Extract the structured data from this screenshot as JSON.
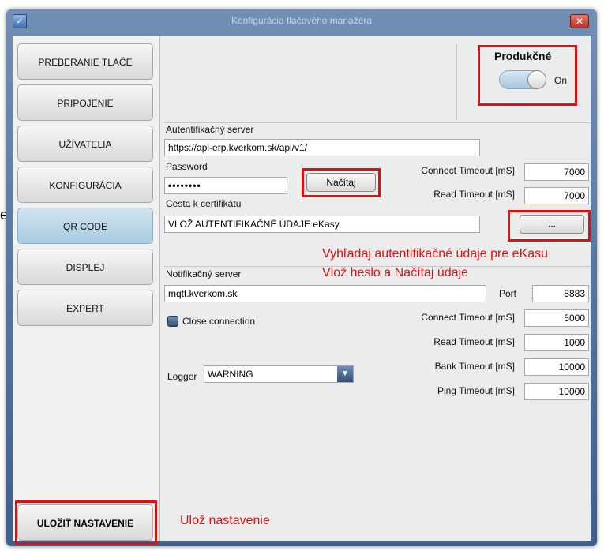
{
  "stray_text": "e",
  "window": {
    "title": "Konfigurácia tlačového manažéra",
    "close_glyph": "✕",
    "app_glyph": "✓"
  },
  "sidebar": {
    "items": [
      {
        "label": "PREBERANIE TLAČE"
      },
      {
        "label": "PRIPOJENIE"
      },
      {
        "label": "UŽÍVATELIA"
      },
      {
        "label": "KONFIGURÁCIA"
      },
      {
        "label": "QR CODE"
      },
      {
        "label": "DISPLEJ"
      },
      {
        "label": "EXPERT"
      }
    ],
    "active": "QR CODE",
    "save_label": "ULOŽIŤ NASTAVENIE"
  },
  "production": {
    "label": "Produkčné",
    "state": "On"
  },
  "auth": {
    "server_label": "Autentifikačný server",
    "server_value": "https://api-erp.kverkom.sk/api/v1/",
    "password_label": "Password",
    "password_value": "••••••••",
    "load_button": "Načítaj",
    "connect_timeout_label": "Connect Timeout [mS]",
    "connect_timeout_value": "7000",
    "read_timeout_label": "Read Timeout [mS]",
    "read_timeout_value": "7000",
    "cert_label": "Cesta k certifikátu",
    "cert_value": "VLOŽ AUTENTIFIKAČNÉ ÚDAJE eKasy",
    "browse_button": "..."
  },
  "notification": {
    "server_label": "Notifikačný server",
    "server_value": "mqtt.kverkom.sk",
    "port_label": "Port",
    "port_value": "8883",
    "close_connection_label": "Close connection",
    "connect_timeout_label": "Connect Timeout [mS]",
    "connect_timeout_value": "5000",
    "read_timeout_label": "Read Timeout [mS]",
    "read_timeout_value": "1000",
    "bank_timeout_label": "Bank Timeout [mS]",
    "bank_timeout_value": "10000",
    "ping_timeout_label": "Ping Timeout [mS]",
    "ping_timeout_value": "10000",
    "logger_label": "Logger",
    "logger_value": "WARNING"
  },
  "annotations": {
    "find_auth": "Vyhľadaj autentifikačné údaje pre eKasu",
    "enter_password": "Vlož heslo a Načítaj údaje",
    "save_note": "Ulož nastavenie"
  },
  "colors": {
    "annotation": "#e01010",
    "active_nav": "#a9cbe2",
    "title_bar": "#3d5f8c"
  }
}
